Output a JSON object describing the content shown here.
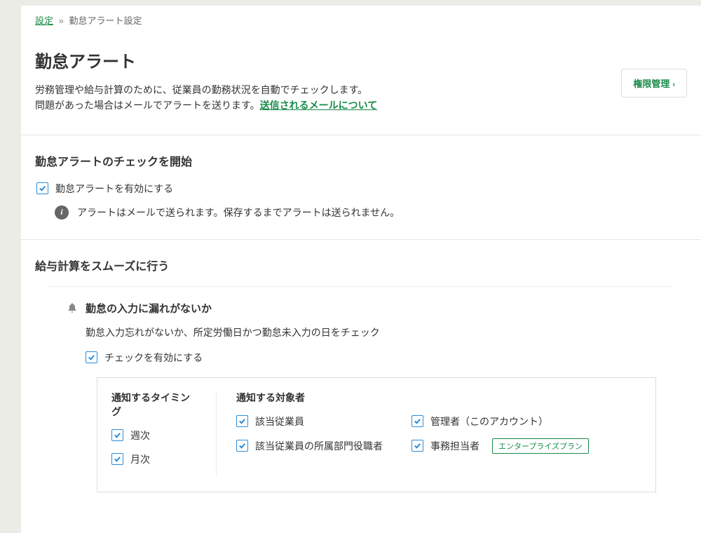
{
  "breadcrumb": {
    "link": "設定",
    "current": "勤怠アラート設定"
  },
  "header": {
    "title": "勤怠アラート",
    "desc1": "労務管理や給与計算のために、従業員の勤務状況を自動でチェックします。",
    "desc2_prefix": "問題があった場合はメールでアラートを送ります。",
    "desc2_link": "送信されるメールについて",
    "perm_button": "権限管理"
  },
  "section_start": {
    "title": "勤怠アラートのチェックを開始",
    "checkbox_label": "勤怠アラートを有効にする",
    "info_text": "アラートはメールで送られます。保存するまでアラートは送られません。"
  },
  "section_payroll": {
    "title": "給与計算をスムーズに行う",
    "item": {
      "title": "勤怠の入力に漏れがないか",
      "desc": "勤怠入力忘れがないか、所定労働日かつ勤怠未入力の日をチェック",
      "enable_label": "チェックを有効にする",
      "timing_heading": "通知するタイミング",
      "timing_opts": {
        "weekly": "週次",
        "monthly": "月次"
      },
      "target_heading": "通知する対象者",
      "target_opts": {
        "employee": "該当従業員",
        "dept_manager": "該当従業員の所属部門役職者",
        "admin": "管理者（このアカウント）",
        "clerk": "事務担当者"
      },
      "enterprise_tag": "エンタープライズプラン"
    }
  }
}
